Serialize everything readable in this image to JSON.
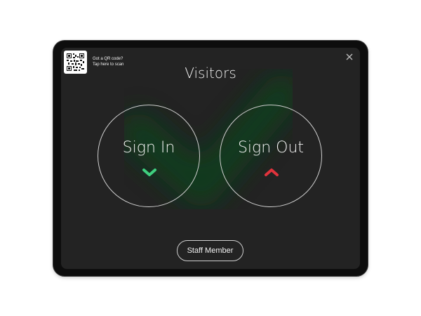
{
  "header": {
    "qr_prompt_line1": "Got a QR code?",
    "qr_prompt_line2": "Tap here to scan",
    "title": "Visitors"
  },
  "actions": {
    "sign_in_label": "Sign In",
    "sign_out_label": "Sign Out",
    "staff_label": "Staff Member"
  },
  "colors": {
    "screen_bg": "#232323",
    "sign_in_accent": "#3fcf7f",
    "sign_out_accent": "#e0333c",
    "background_glow": "#0b3f1c"
  },
  "icons": {
    "qr": "qr-code-icon",
    "close": "close-icon",
    "sign_in": "chevron-down-icon",
    "sign_out": "chevron-up-icon"
  }
}
